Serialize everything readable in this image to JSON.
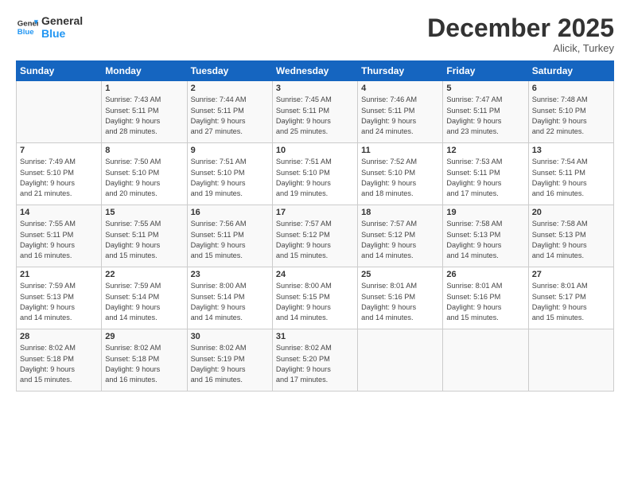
{
  "header": {
    "logo_line1": "General",
    "logo_line2": "Blue",
    "month": "December 2025",
    "location": "Alicik, Turkey"
  },
  "weekdays": [
    "Sunday",
    "Monday",
    "Tuesday",
    "Wednesday",
    "Thursday",
    "Friday",
    "Saturday"
  ],
  "weeks": [
    [
      {
        "day": "",
        "info": ""
      },
      {
        "day": "1",
        "info": "Sunrise: 7:43 AM\nSunset: 5:11 PM\nDaylight: 9 hours\nand 28 minutes."
      },
      {
        "day": "2",
        "info": "Sunrise: 7:44 AM\nSunset: 5:11 PM\nDaylight: 9 hours\nand 27 minutes."
      },
      {
        "day": "3",
        "info": "Sunrise: 7:45 AM\nSunset: 5:11 PM\nDaylight: 9 hours\nand 25 minutes."
      },
      {
        "day": "4",
        "info": "Sunrise: 7:46 AM\nSunset: 5:11 PM\nDaylight: 9 hours\nand 24 minutes."
      },
      {
        "day": "5",
        "info": "Sunrise: 7:47 AM\nSunset: 5:11 PM\nDaylight: 9 hours\nand 23 minutes."
      },
      {
        "day": "6",
        "info": "Sunrise: 7:48 AM\nSunset: 5:10 PM\nDaylight: 9 hours\nand 22 minutes."
      }
    ],
    [
      {
        "day": "7",
        "info": "Sunrise: 7:49 AM\nSunset: 5:10 PM\nDaylight: 9 hours\nand 21 minutes."
      },
      {
        "day": "8",
        "info": "Sunrise: 7:50 AM\nSunset: 5:10 PM\nDaylight: 9 hours\nand 20 minutes."
      },
      {
        "day": "9",
        "info": "Sunrise: 7:51 AM\nSunset: 5:10 PM\nDaylight: 9 hours\nand 19 minutes."
      },
      {
        "day": "10",
        "info": "Sunrise: 7:51 AM\nSunset: 5:10 PM\nDaylight: 9 hours\nand 19 minutes."
      },
      {
        "day": "11",
        "info": "Sunrise: 7:52 AM\nSunset: 5:10 PM\nDaylight: 9 hours\nand 18 minutes."
      },
      {
        "day": "12",
        "info": "Sunrise: 7:53 AM\nSunset: 5:11 PM\nDaylight: 9 hours\nand 17 minutes."
      },
      {
        "day": "13",
        "info": "Sunrise: 7:54 AM\nSunset: 5:11 PM\nDaylight: 9 hours\nand 16 minutes."
      }
    ],
    [
      {
        "day": "14",
        "info": "Sunrise: 7:55 AM\nSunset: 5:11 PM\nDaylight: 9 hours\nand 16 minutes."
      },
      {
        "day": "15",
        "info": "Sunrise: 7:55 AM\nSunset: 5:11 PM\nDaylight: 9 hours\nand 15 minutes."
      },
      {
        "day": "16",
        "info": "Sunrise: 7:56 AM\nSunset: 5:11 PM\nDaylight: 9 hours\nand 15 minutes."
      },
      {
        "day": "17",
        "info": "Sunrise: 7:57 AM\nSunset: 5:12 PM\nDaylight: 9 hours\nand 15 minutes."
      },
      {
        "day": "18",
        "info": "Sunrise: 7:57 AM\nSunset: 5:12 PM\nDaylight: 9 hours\nand 14 minutes."
      },
      {
        "day": "19",
        "info": "Sunrise: 7:58 AM\nSunset: 5:13 PM\nDaylight: 9 hours\nand 14 minutes."
      },
      {
        "day": "20",
        "info": "Sunrise: 7:58 AM\nSunset: 5:13 PM\nDaylight: 9 hours\nand 14 minutes."
      }
    ],
    [
      {
        "day": "21",
        "info": "Sunrise: 7:59 AM\nSunset: 5:13 PM\nDaylight: 9 hours\nand 14 minutes."
      },
      {
        "day": "22",
        "info": "Sunrise: 7:59 AM\nSunset: 5:14 PM\nDaylight: 9 hours\nand 14 minutes."
      },
      {
        "day": "23",
        "info": "Sunrise: 8:00 AM\nSunset: 5:14 PM\nDaylight: 9 hours\nand 14 minutes."
      },
      {
        "day": "24",
        "info": "Sunrise: 8:00 AM\nSunset: 5:15 PM\nDaylight: 9 hours\nand 14 minutes."
      },
      {
        "day": "25",
        "info": "Sunrise: 8:01 AM\nSunset: 5:16 PM\nDaylight: 9 hours\nand 14 minutes."
      },
      {
        "day": "26",
        "info": "Sunrise: 8:01 AM\nSunset: 5:16 PM\nDaylight: 9 hours\nand 15 minutes."
      },
      {
        "day": "27",
        "info": "Sunrise: 8:01 AM\nSunset: 5:17 PM\nDaylight: 9 hours\nand 15 minutes."
      }
    ],
    [
      {
        "day": "28",
        "info": "Sunrise: 8:02 AM\nSunset: 5:18 PM\nDaylight: 9 hours\nand 15 minutes."
      },
      {
        "day": "29",
        "info": "Sunrise: 8:02 AM\nSunset: 5:18 PM\nDaylight: 9 hours\nand 16 minutes."
      },
      {
        "day": "30",
        "info": "Sunrise: 8:02 AM\nSunset: 5:19 PM\nDaylight: 9 hours\nand 16 minutes."
      },
      {
        "day": "31",
        "info": "Sunrise: 8:02 AM\nSunset: 5:20 PM\nDaylight: 9 hours\nand 17 minutes."
      },
      {
        "day": "",
        "info": ""
      },
      {
        "day": "",
        "info": ""
      },
      {
        "day": "",
        "info": ""
      }
    ]
  ]
}
